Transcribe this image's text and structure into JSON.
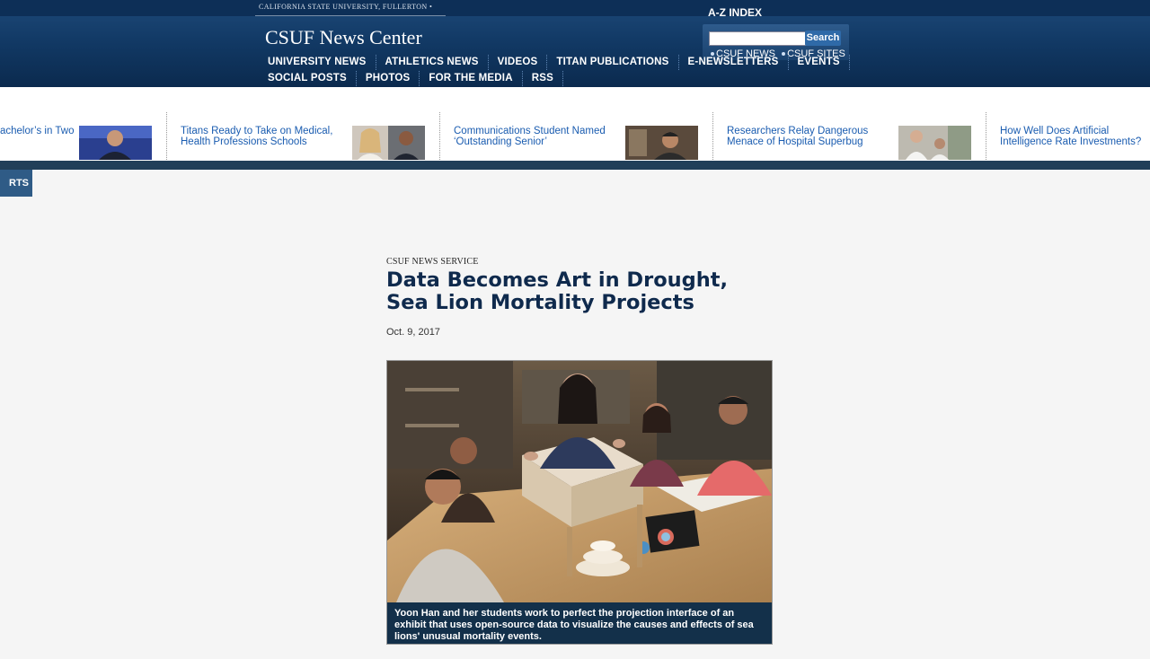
{
  "header": {
    "university": "CALIFORNIA STATE UNIVERSITY, FULLERTON •",
    "site_title": "CSUF News Center",
    "az_index": "A-Z INDEX",
    "search": {
      "button": "Search",
      "value": "",
      "option_news": "CSUF NEWS",
      "option_sites": "CSUF SITES"
    },
    "nav_row1": [
      "UNIVERSITY NEWS",
      "ATHLETICS NEWS",
      "VIDEOS",
      "TITAN PUBLICATIONS",
      "E-NEWSLETTERS",
      "EVENTS"
    ],
    "nav_row2": [
      "SOCIAL POSTS",
      "PHOTOS",
      "FOR THE MEDIA",
      "RSS"
    ]
  },
  "stories": [
    {
      "text": "achelor’s in Two"
    },
    {
      "text": "Titans Ready to Take on Medical, Health Professions Schools"
    },
    {
      "text": "Communications Student Named ‘Outstanding Senior’"
    },
    {
      "text": "Researchers Relay Dangerous Menace of Hospital Superbug"
    },
    {
      "text": "How Well Does Artificial Intelligence Rate Investments?"
    }
  ],
  "sports_tab": "RTS",
  "article": {
    "kicker": "CSUF NEWS SERVICE",
    "headline": "Data Becomes Art in Drought, Sea Lion Mortality Projects",
    "date": "Oct. 9, 2017",
    "caption": "Yoon Han and her students work to perfect the projection interface of an exhibit that uses open-source data to visualize the causes and effects of sea lions' unusual mortality events."
  },
  "colors": {
    "header_navy": "#0b2a4e",
    "link_blue": "#1a5cb0",
    "headline": "#0f2a4d",
    "caption_bg": "#13304a"
  }
}
